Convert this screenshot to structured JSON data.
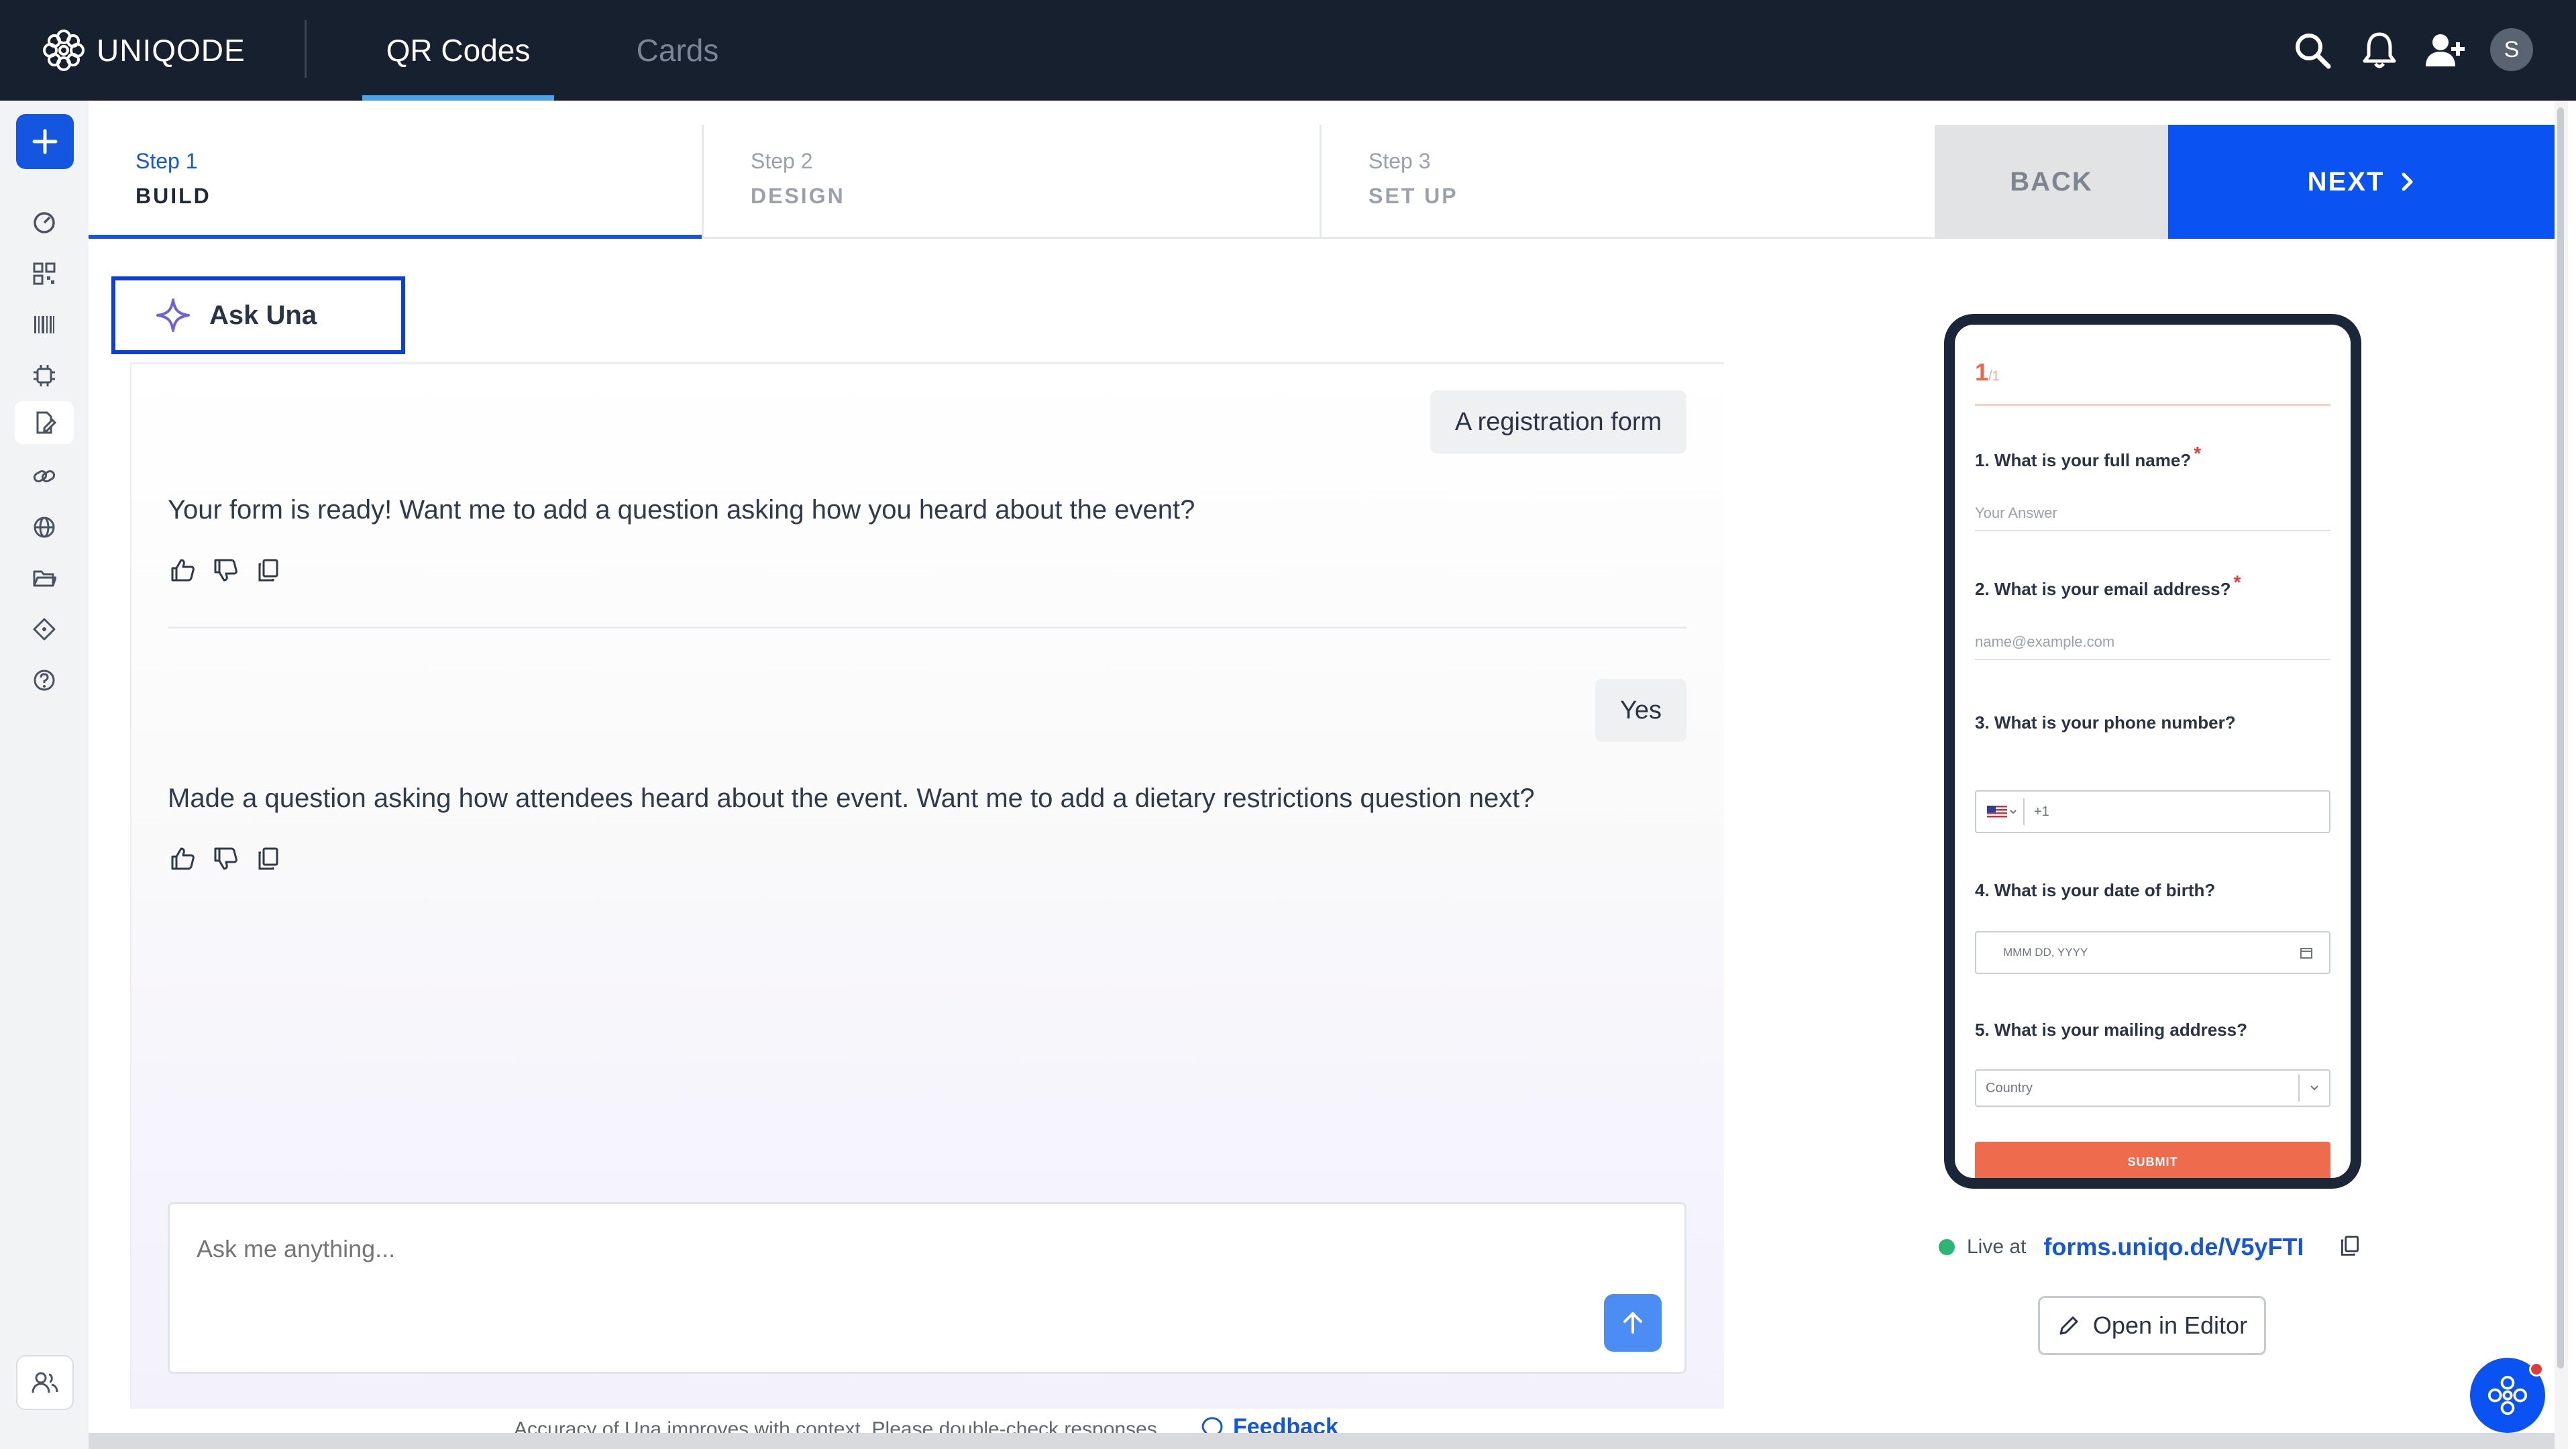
{
  "app": {
    "brand": "UNIQODE"
  },
  "top_tabs": [
    {
      "label": "QR Codes",
      "active": true
    },
    {
      "label": "Cards",
      "active": false
    }
  ],
  "top_icons": [
    "search-icon",
    "bell-icon",
    "add-user-icon"
  ],
  "user": {
    "initial": "S"
  },
  "sidebar": {
    "icons": [
      "dashboard-icon",
      "qr-grid-icon",
      "barcode-icon",
      "ai-chip-icon",
      "form-icon",
      "link-icon",
      "globe-icon",
      "folder-icon",
      "tag-icon",
      "help-icon"
    ],
    "active_index": 4,
    "bottom_icon": "team-icon"
  },
  "steps": [
    {
      "num": "Step 1",
      "name": "BUILD",
      "active": true
    },
    {
      "num": "Step 2",
      "name": "DESIGN",
      "active": false
    },
    {
      "num": "Step 3",
      "name": "SET UP",
      "active": false
    }
  ],
  "actions": {
    "back": "BACK",
    "next": "NEXT"
  },
  "ask_una": {
    "label": "Ask Una"
  },
  "chat": {
    "messages": [
      {
        "role": "user",
        "text": "A registration form"
      },
      {
        "role": "assistant",
        "text": "Your form is ready! Want me to add a question asking how you heard about the event?"
      },
      {
        "role": "user",
        "text": "Yes"
      },
      {
        "role": "assistant",
        "text": "Made a question asking how attendees heard about the event. Want me to add a dietary restrictions question next?"
      }
    ],
    "input_placeholder": "Ask me anything...",
    "footnote": "Accuracy of Una improves with context. Please double-check responses.",
    "feedback_label": "Feedback"
  },
  "preview": {
    "page_current": "1",
    "page_total": "/1",
    "questions": [
      {
        "label": "1. What is your full name?",
        "required": true,
        "placeholder": "Your Answer"
      },
      {
        "label": "2. What is your email address?",
        "required": true,
        "placeholder": "name@example.com"
      },
      {
        "label": "3. What is your phone number?",
        "required": false,
        "placeholder": "+1"
      },
      {
        "label": "4. What is your date of birth?",
        "required": false,
        "placeholder": "MMM DD, YYYY"
      },
      {
        "label": "5. What is your mailing address?",
        "required": false,
        "placeholder": "Country"
      }
    ],
    "required_mark": "*",
    "submit_label": "SUBMIT"
  },
  "live": {
    "label": "Live at",
    "url": "forms.uniqo.de/V5yFTI"
  },
  "open_editor": {
    "label": "Open in Editor"
  },
  "colors": {
    "topbar": "#16202f",
    "accent": "#0b52f2",
    "submit": "#ee6b4e",
    "live": "#2bb673"
  }
}
